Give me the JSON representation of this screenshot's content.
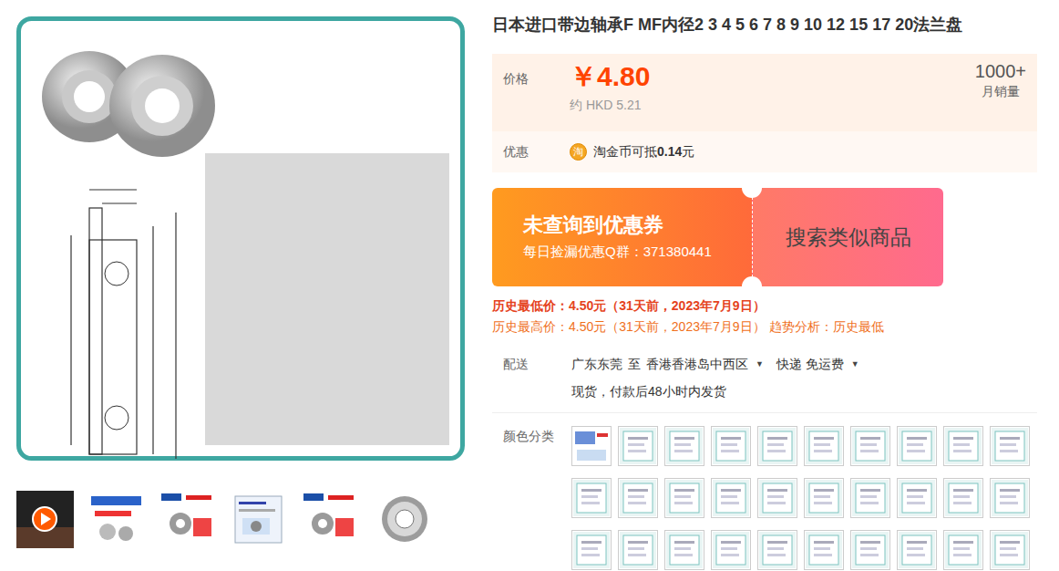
{
  "title": "日本进口带边轴承F MF内径2 3 4 5 6 7 8 9 10 12 15 17 20法兰盘",
  "price": {
    "label": "价格",
    "value": "￥4.80",
    "converted": "约 HKD 5.21"
  },
  "sales": {
    "count": "1000+",
    "label": "月销量"
  },
  "discount": {
    "label": "优惠",
    "coin_icon": "淘",
    "prefix": "淘金币可抵",
    "amount": "0.14",
    "unit": "元"
  },
  "coupon": {
    "title": "未查询到优惠券",
    "subtitle": "每日捡漏优惠Q群：371380441",
    "search_button": "搜索类似商品"
  },
  "history": {
    "lowest": "历史最低价：4.50元（31天前，2023年7月9日）",
    "highest": "历史最高价：4.50元（31天前，2023年7月9日）",
    "trend": "趋势分析：历史最低"
  },
  "delivery": {
    "label": "配送",
    "from": "广东东莞",
    "to_word": "至",
    "to": "香港香港岛中西区",
    "to_arrow": "▼",
    "method": "快递 免运费",
    "method_arrow": "▼",
    "stock": "现货，付款后48小时内发货"
  },
  "thumbnails": [
    {
      "kind": "video"
    },
    {
      "kind": "promo"
    },
    {
      "kind": "nsk"
    },
    {
      "kind": "doc"
    },
    {
      "kind": "nsk"
    },
    {
      "kind": "bearing"
    }
  ],
  "variants": {
    "label": "颜色分类",
    "items": [
      {
        "kind": "photo"
      },
      {
        "kind": "tag"
      },
      {
        "kind": "tag"
      },
      {
        "kind": "tag"
      },
      {
        "kind": "tag"
      },
      {
        "kind": "tag"
      },
      {
        "kind": "tag"
      },
      {
        "kind": "tag"
      },
      {
        "kind": "tag"
      },
      {
        "kind": "tag"
      },
      {
        "kind": "tag"
      },
      {
        "kind": "tag"
      },
      {
        "kind": "tag"
      },
      {
        "kind": "tag"
      },
      {
        "kind": "tag"
      },
      {
        "kind": "tag"
      },
      {
        "kind": "tag"
      },
      {
        "kind": "tag"
      },
      {
        "kind": "tag"
      },
      {
        "kind": "tag"
      },
      {
        "kind": "tag"
      },
      {
        "kind": "tag"
      },
      {
        "kind": "tag"
      },
      {
        "kind": "tag"
      },
      {
        "kind": "tag"
      },
      {
        "kind": "tag"
      },
      {
        "kind": "tag"
      },
      {
        "kind": "tag"
      },
      {
        "kind": "tag"
      },
      {
        "kind": "tag"
      }
    ]
  }
}
